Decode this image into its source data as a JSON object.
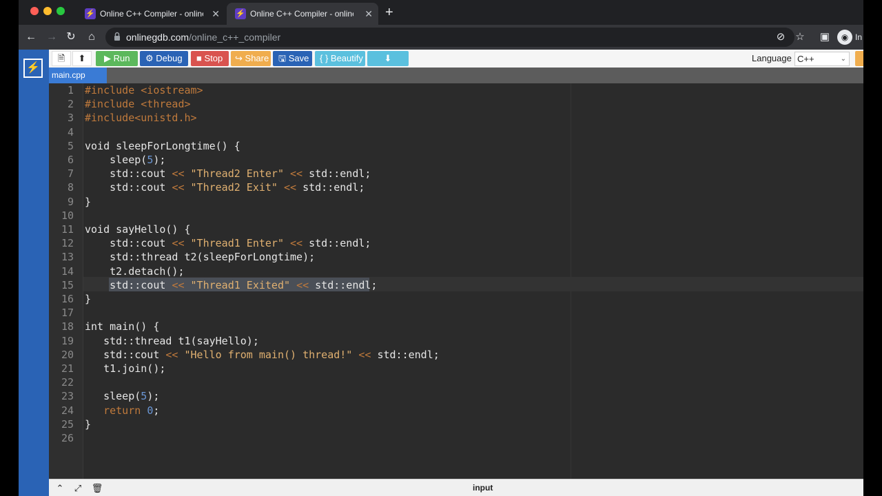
{
  "browser": {
    "tabs": [
      {
        "title": "Online C++ Compiler - online e",
        "active": false
      },
      {
        "title": "Online C++ Compiler - online e",
        "active": true
      }
    ],
    "new_tab": "+",
    "url_host": "onlinegdb.com",
    "url_path": "/online_c++_compiler",
    "profile_text": "In"
  },
  "toolbar": {
    "run": "Run",
    "debug": "Debug",
    "stop": "Stop",
    "share": "Share",
    "save": "Save",
    "beautify": "{ } Beautify",
    "language_label": "Language",
    "language_value": "C++"
  },
  "colors": {
    "run": "#5cb85c",
    "debug": "#2a63b5",
    "stop": "#d9534f",
    "share": "#f0ad4e",
    "save": "#2a63b5",
    "beautify": "#5bc0de",
    "download": "#5bc0de",
    "sidebar": "#2a63b5",
    "file_tab": "#3a7bd5"
  },
  "file_tab": "main.cpp",
  "editor": {
    "line_numbers": [
      "1",
      "2",
      "3",
      "4",
      "5",
      "6",
      "7",
      "8",
      "9",
      "10",
      "11",
      "12",
      "13",
      "14",
      "15",
      "16",
      "17",
      "18",
      "19",
      "20",
      "21",
      "22",
      "23",
      "24",
      "25",
      "26"
    ],
    "selected_line": 15,
    "lines": [
      "#include <iostream>",
      "#include <thread>",
      "#include<unistd.h>",
      "",
      "void sleepForLongtime() {",
      "    sleep(5);",
      "    std::cout << \"Thread2 Enter\" << std::endl;",
      "    std::cout << \"Thread2 Exit\" << std::endl;",
      "}",
      "",
      "void sayHello() {",
      "    std::cout << \"Thread1 Enter\" << std::endl;",
      "    std::thread t2(sleepForLongtime);",
      "    t2.detach();",
      "    std::cout << \"Thread1 Exited\" << std::endl;",
      "}",
      "",
      "int main() {",
      "   std::thread t1(sayHello);",
      "   std::cout << \"Hello from main() thread!\" << std::endl;",
      "   t1.join();",
      "",
      "   sleep(5);",
      "   return 0;",
      "}",
      ""
    ]
  },
  "bottom": {
    "input_label": "input"
  }
}
